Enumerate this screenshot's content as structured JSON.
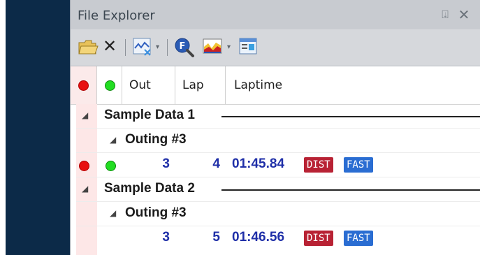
{
  "panel": {
    "title": "File Explorer",
    "pin_glyph": "⍗",
    "close_glyph": "✕"
  },
  "toolbar": {
    "items": [
      {
        "name": "open-folder-icon"
      },
      {
        "name": "delete-icon",
        "glyph": "✕"
      },
      {
        "name": "channel-compare-icon"
      },
      {
        "name": "search-icon",
        "label": "F"
      },
      {
        "name": "chart-icon"
      },
      {
        "name": "properties-icon"
      }
    ],
    "dropdown_glyph": "▾"
  },
  "columns": [
    {
      "key": "red_marker",
      "label": ""
    },
    {
      "key": "green_marker",
      "label": ""
    },
    {
      "key": "out",
      "label": "Out"
    },
    {
      "key": "lap",
      "label": "Lap"
    },
    {
      "key": "laptime",
      "label": "Laptime"
    }
  ],
  "tree": [
    {
      "group": "Sample Data 1",
      "outing_label": "Outing #3",
      "rows": [
        {
          "out": "3",
          "lap": "4",
          "laptime": "01:45.84",
          "badges": [
            "DIST",
            "FAST"
          ],
          "red_marker": true,
          "green_marker": true
        }
      ]
    },
    {
      "group": "Sample Data 2",
      "outing_label": "Outing #3",
      "rows": [
        {
          "out": "3",
          "lap": "5",
          "laptime": "01:46.56",
          "badges": [
            "DIST",
            "FAST"
          ],
          "red_marker": false,
          "green_marker": false
        }
      ]
    }
  ],
  "expand_glyph": "◢",
  "colors": {
    "dark_panel": "#0c2a48",
    "value_text": "#1f2fa8",
    "dist_badge": "#b82234",
    "fast_badge": "#2a6dd2",
    "marker_red": "#e81010",
    "marker_green": "#22dd22"
  }
}
